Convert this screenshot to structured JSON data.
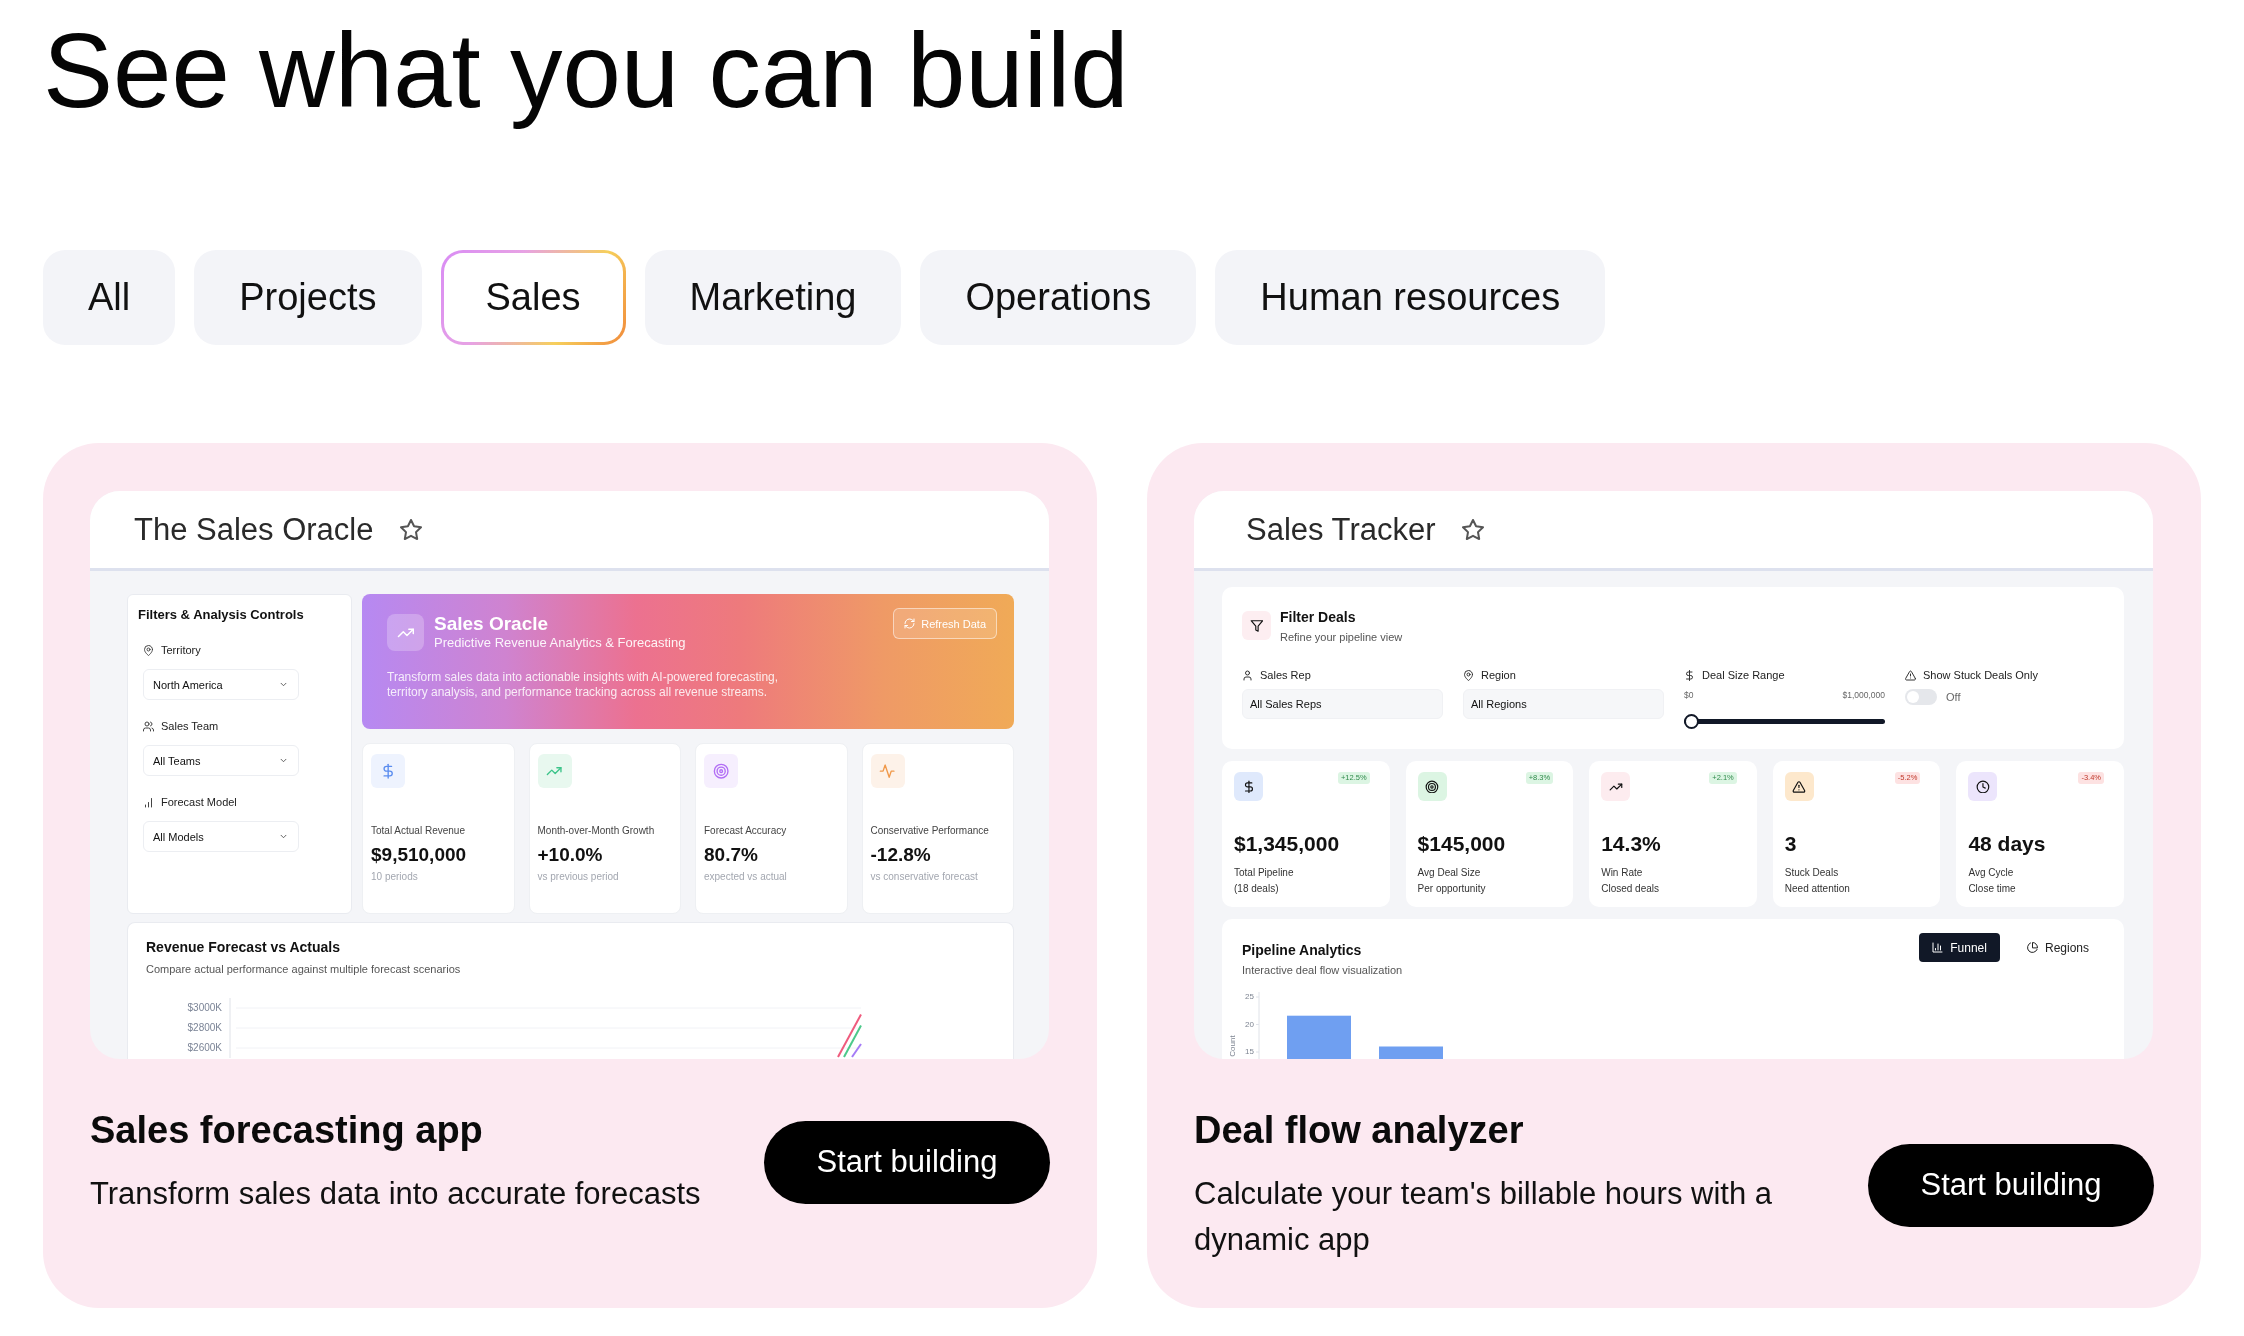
{
  "heading": "See what you can build",
  "tabs": [
    {
      "label": "All",
      "selected": false
    },
    {
      "label": "Projects",
      "selected": false
    },
    {
      "label": "Sales",
      "selected": true
    },
    {
      "label": "Marketing",
      "selected": false
    },
    {
      "label": "Operations",
      "selected": false
    },
    {
      "label": "Human resources",
      "selected": false
    }
  ],
  "templates": [
    {
      "preview": {
        "kind": "forecast",
        "title": "The Sales Oracle",
        "filters": {
          "title": "Filters & Analysis Controls",
          "fields": [
            {
              "label": "Territory",
              "value": "North America"
            },
            {
              "label": "Sales Team",
              "value": "All Teams"
            },
            {
              "label": "Forecast Model",
              "value": "All Models"
            }
          ]
        },
        "hero": {
          "title": "Sales Oracle",
          "subtitle": "Predictive Revenue Analytics & Forecasting",
          "description": "Transform sales data into actionable insights with AI-powered forecasting, territory analysis, and performance tracking across all revenue streams.",
          "button": "Refresh Data"
        },
        "stats": [
          {
            "label": "Total Actual Revenue",
            "value": "$9,510,000",
            "note": "10 periods"
          },
          {
            "label": "Month-over-Month Growth",
            "value": "+10.0%",
            "note": "vs previous period"
          },
          {
            "label": "Forecast Accuracy",
            "value": "80.7%",
            "note": "expected vs actual"
          },
          {
            "label": "Conservative Performance",
            "value": "-12.8%",
            "note": "vs conservative forecast"
          }
        ],
        "chart": {
          "title": "Revenue Forecast vs Actuals",
          "subtitle": "Compare actual performance against multiple forecast scenarios",
          "axis_labels": [
            "$3000K",
            "$2800K",
            "$2600K"
          ]
        }
      },
      "name": "Sales forecasting app",
      "description": "Transform sales data into accurate forecasts",
      "button": "Start building"
    },
    {
      "preview": {
        "kind": "tracker",
        "title": "Sales Tracker",
        "filters": {
          "title": "Filter Deals",
          "subtitle": "Refine your pipeline view",
          "fields": [
            {
              "kind": "select",
              "label": "Sales Rep",
              "value": "All Sales Reps"
            },
            {
              "kind": "select",
              "label": "Region",
              "value": "All Regions"
            },
            {
              "kind": "range",
              "label": "Deal Size Range",
              "min": "$0",
              "max": "$1,000,000",
              "level": 0
            },
            {
              "kind": "toggle",
              "label": "Show Stuck Deals Only",
              "on": false,
              "state": "Off"
            }
          ]
        },
        "metrics": [
          {
            "change": "+12.5%",
            "positive": true,
            "value": "$1,345,000",
            "label": "Total Pipeline",
            "note": "(18 deals)"
          },
          {
            "change": "+8.3%",
            "positive": true,
            "value": "$145,000",
            "label": "Avg Deal Size",
            "note": "Per opportunity"
          },
          {
            "change": "+2.1%",
            "positive": true,
            "value": "14.3%",
            "label": "Win Rate",
            "note": "Closed deals"
          },
          {
            "change": "-5.2%",
            "positive": false,
            "value": "3",
            "label": "Stuck Deals",
            "note": "Need attention"
          },
          {
            "change": "-3.4%",
            "positive": false,
            "value": "48 days",
            "label": "Avg Cycle",
            "note": "Close time"
          }
        ],
        "chart": {
          "title": "Pipeline Analytics",
          "subtitle": "Interactive deal flow visualization",
          "views": [
            {
              "label": "Funnel",
              "selected": true
            },
            {
              "label": "Regions",
              "selected": false
            }
          ],
          "axis_labels": [
            "25",
            "20",
            "15"
          ],
          "axis_title": "Count"
        }
      },
      "name": "Deal flow analyzer",
      "description": "Calculate your team's billable hours with a dynamic app",
      "button": "Start building"
    }
  ]
}
